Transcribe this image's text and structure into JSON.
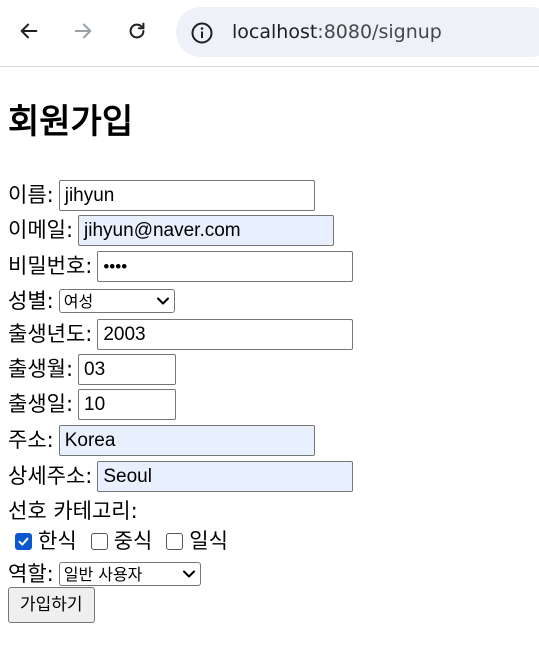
{
  "browser": {
    "url_host": "localhost",
    "url_rest": ":8080/signup"
  },
  "page": {
    "title": "회원가입"
  },
  "form": {
    "name": {
      "label": "이름:",
      "value": "jihyun"
    },
    "email": {
      "label": "이메일:",
      "value": "jihyun@naver.com"
    },
    "password": {
      "label": "비밀번호:",
      "value": "••••"
    },
    "gender": {
      "label": "성별:",
      "value": "여성"
    },
    "birth_year": {
      "label": "출생년도:",
      "value": "2003"
    },
    "birth_month": {
      "label": "출생월:",
      "value": "03"
    },
    "birth_day": {
      "label": "출생일:",
      "value": "10"
    },
    "address": {
      "label": "주소:",
      "value": "Korea"
    },
    "address_detail": {
      "label": "상세주소:",
      "value": "Seoul"
    },
    "category": {
      "label": "선호 카테고리:",
      "options": [
        {
          "label": "한식",
          "checked": true
        },
        {
          "label": "중식",
          "checked": false
        },
        {
          "label": "일식",
          "checked": false
        }
      ]
    },
    "role": {
      "label": "역할:",
      "value": "일반 사용자"
    },
    "submit_label": "가입하기"
  }
}
